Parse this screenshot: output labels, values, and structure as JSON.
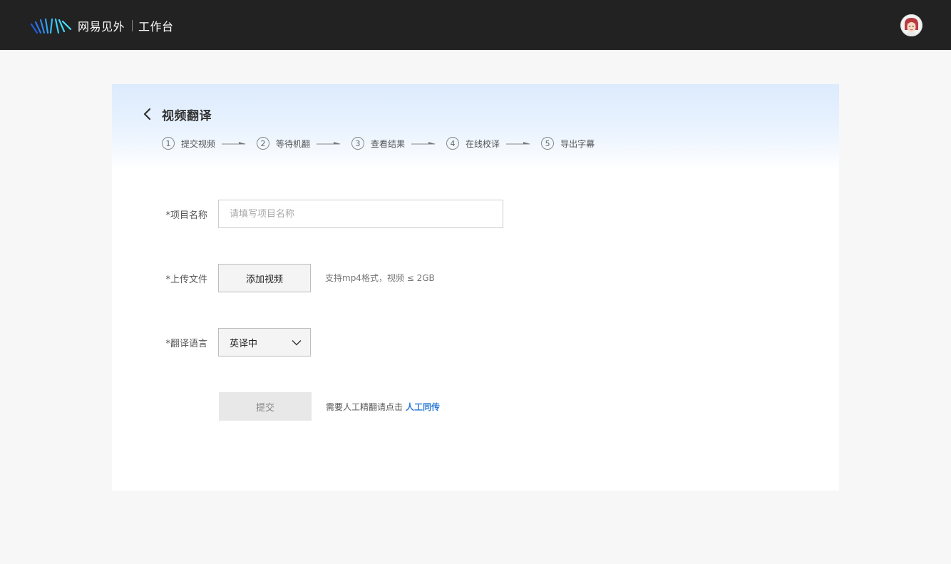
{
  "header": {
    "brand_name": "网易见外",
    "brand_sub": "工作台",
    "logo_icon": "netease-jianwai-logo-icon",
    "avatar_icon": "user-avatar-icon"
  },
  "page": {
    "title": "视频翻译",
    "back_icon": "chevron-left-icon"
  },
  "steps": [
    {
      "num": "1",
      "label": "提交视频"
    },
    {
      "num": "2",
      "label": "等待机翻"
    },
    {
      "num": "3",
      "label": "查看结果"
    },
    {
      "num": "4",
      "label": "在线校译"
    },
    {
      "num": "5",
      "label": "导出字幕"
    }
  ],
  "form": {
    "project_name": {
      "label": "*项目名称",
      "placeholder": "请填写项目名称",
      "value": ""
    },
    "upload": {
      "label": "*上传文件",
      "button": "添加视频",
      "hint": "支持mp4格式，视频 ≤ 2GB"
    },
    "language": {
      "label": "*翻译语言",
      "selected": "英译中"
    },
    "submit": {
      "button": "提交",
      "hint": "需要人工精翻请点击",
      "link": "人工同传"
    }
  },
  "colors": {
    "topbar": "#222222",
    "link": "#2f7bd6",
    "card_gradient_top": "#dcebfd",
    "page_bg": "#f7f7f7"
  }
}
